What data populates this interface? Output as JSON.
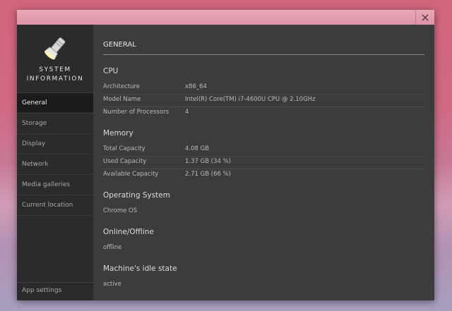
{
  "window": {
    "close_glyph": "×"
  },
  "sidebar": {
    "app_title_line1": "SYSTEM",
    "app_title_line2": "INFORMATION",
    "logo_icon": "flashlight-icon",
    "items": [
      {
        "label": "General",
        "active": true
      },
      {
        "label": "Storage"
      },
      {
        "label": "Display"
      },
      {
        "label": "Network"
      },
      {
        "label": "Media galleries"
      },
      {
        "label": "Current location"
      }
    ],
    "settings_label": "App settings"
  },
  "main": {
    "title": "GENERAL",
    "cpu": {
      "heading": "CPU",
      "rows": [
        {
          "label": "Architecture",
          "value": "x86_64"
        },
        {
          "label": "Model Name",
          "value": "Intel(R) Core(TM) i7-4600U CPU @ 2.10GHz"
        },
        {
          "label": "Number of Processors",
          "value": "4"
        }
      ]
    },
    "memory": {
      "heading": "Memory",
      "rows": [
        {
          "label": "Total Capacity",
          "value": "4.08 GB"
        },
        {
          "label": "Used Capacity",
          "value": "1.37 GB (34 %)"
        },
        {
          "label": "Available Capacity",
          "value": "2.71 GB (66 %)"
        }
      ]
    },
    "os": {
      "heading": "Operating System",
      "value": "Chrome OS"
    },
    "online": {
      "heading": "Online/Offline",
      "value": "offline"
    },
    "idle": {
      "heading": "Machine's idle state",
      "value": "active"
    }
  }
}
